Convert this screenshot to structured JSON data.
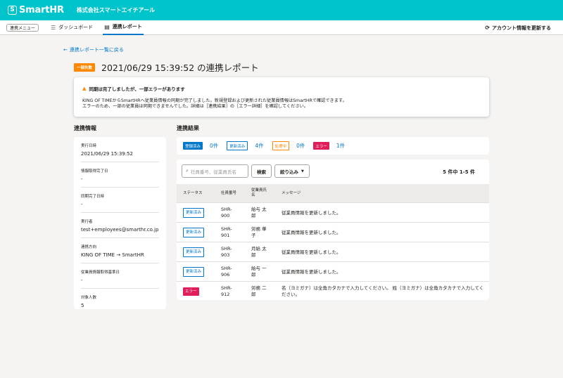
{
  "header": {
    "logo_text": "SmartHR",
    "company": "株式会社スマートエイチアール",
    "brand_color": "#00c4cc"
  },
  "subnav": {
    "menu_label": "連携メニュー",
    "tabs": [
      {
        "label": "ダッシュボード",
        "icon": "list-icon"
      },
      {
        "label": "連携レポート",
        "icon": "document-icon"
      }
    ],
    "refresh_label": "アカウント情報を更新する"
  },
  "page": {
    "back_link": "連携レポート一覧に戻る",
    "badge": "一部失敗",
    "title": "2021/06/29 15:39:52 の連携レポート"
  },
  "alert": {
    "title": "同期は完了しましたが、一部エラーがあります",
    "lines": [
      "KING OF TIMEからSmartHRへ従業員情報の同期が完了しました。新規登録および更新された従業員情報はSmartHRで確認できます。",
      "エラーのため、一部の従業員は同期できませんでした。詳細は［連携結果］の［エラー詳細］を確認してください。"
    ]
  },
  "info": {
    "section_title": "連携情報",
    "items": [
      {
        "label": "実行日時",
        "value": "2021/06/29 15:39:52"
      },
      {
        "label": "情報取得完了日",
        "value": "-"
      },
      {
        "label": "同期完了日時",
        "value": "-"
      },
      {
        "label": "実行者",
        "value": "test+employees@smarthr.co.jp"
      },
      {
        "label": "連携方向",
        "value": "KING OF TIME → SmartHR"
      },
      {
        "label": "従業員情報取得基準日",
        "value": "-"
      },
      {
        "label": "対象人数",
        "value": "5"
      }
    ]
  },
  "results": {
    "section_title": "連携結果",
    "summary": [
      {
        "status": "登録済み",
        "count": "0件"
      },
      {
        "status": "更新済み",
        "count": "4件"
      },
      {
        "status": "処理中",
        "count": "0件"
      },
      {
        "status": "エラー",
        "count": "1件"
      }
    ],
    "search_placeholder": "社員番号、従業員氏名",
    "search_button": "検索",
    "filter_button": "絞り込み",
    "pager": "5 件中 1-5 件",
    "columns": [
      "ステータス",
      "社員番号",
      "従業員氏名",
      "メッセージ"
    ],
    "rows": [
      {
        "status": "更新済み",
        "emp_no": "SHR-900",
        "name": "給与 太郎",
        "message": "従業員情報を更新しました。"
      },
      {
        "status": "更新済み",
        "emp_no": "SHR-901",
        "name": "労務 華子",
        "message": "従業員情報を更新しました。"
      },
      {
        "status": "更新済み",
        "emp_no": "SHR-903",
        "name": "月給 太郎",
        "message": "従業員情報を更新しました。"
      },
      {
        "status": "更新済み",
        "emp_no": "SHR-906",
        "name": "給与 一郎",
        "message": "従業員情報を更新しました。"
      },
      {
        "status": "エラー",
        "emp_no": "SHR-912",
        "name": "労務 二郎",
        "message": "名（ヨミガナ）は全角カタカナで入力してください。 姓（ヨミガナ）は全角カタカナで入力してください。"
      }
    ]
  },
  "colors": {
    "link": "#0077c7",
    "warning": "#ff8800",
    "error": "#e01e5a"
  }
}
